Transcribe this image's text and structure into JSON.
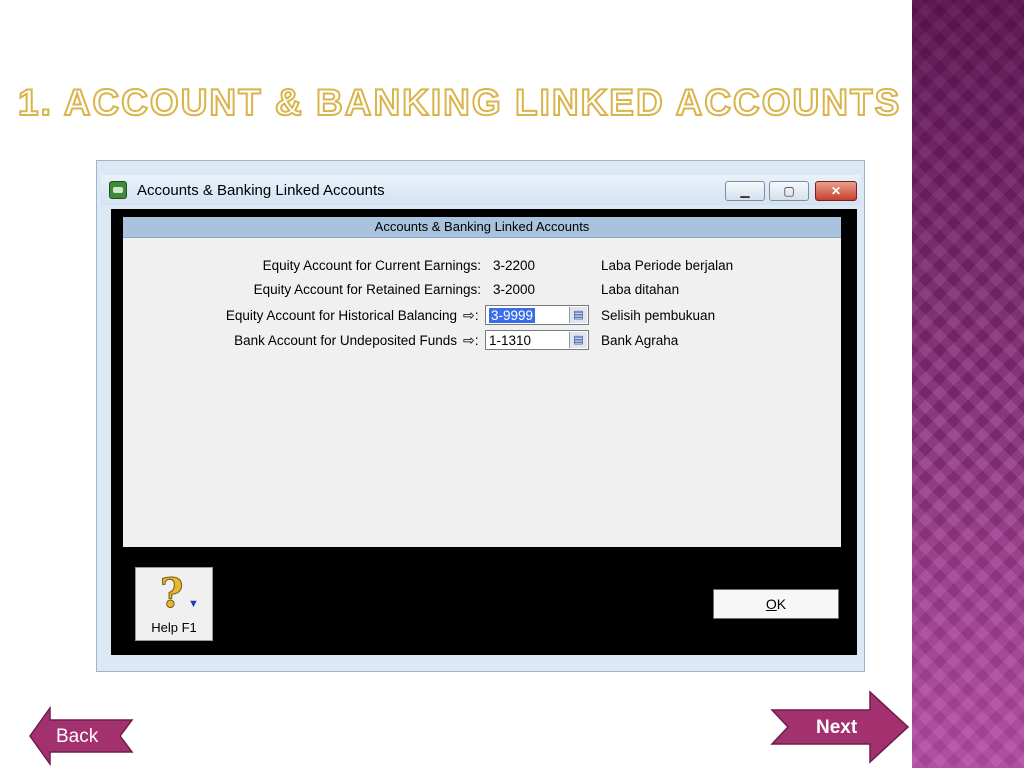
{
  "slide": {
    "title": "1. Account & Banking Linked Accounts",
    "accent_color": "#d9b44a",
    "band_color": "#8a2f7c"
  },
  "window": {
    "title": "Accounts & Banking Linked Accounts",
    "app_icon": "app-icon",
    "controls": {
      "minimize": "▁",
      "maximize": "▢",
      "close": "✕"
    }
  },
  "panel": {
    "header": "Accounts & Banking Linked Accounts",
    "rows": [
      {
        "label": "Equity Account for Current Earnings:",
        "value": "3-2200",
        "description": "Laba Periode berjalan"
      },
      {
        "label": "Equity Account for Retained Earnings:",
        "value": "3-2000",
        "description": "Laba ditahan"
      },
      {
        "label": "Equity Account for Historical Balancing",
        "arrow": "⇨:",
        "value": "3-9999",
        "description": "Selisih pembukuan"
      },
      {
        "label": "Bank Account for Undeposited Funds",
        "arrow": "⇨:",
        "value": "1-1310",
        "description": "Bank Agraha"
      }
    ]
  },
  "buttons": {
    "help": "Help F1",
    "ok_underlined": "O",
    "ok_rest": "K"
  },
  "nav": {
    "back": "Back",
    "next": "Next",
    "color": "#a3306f"
  }
}
